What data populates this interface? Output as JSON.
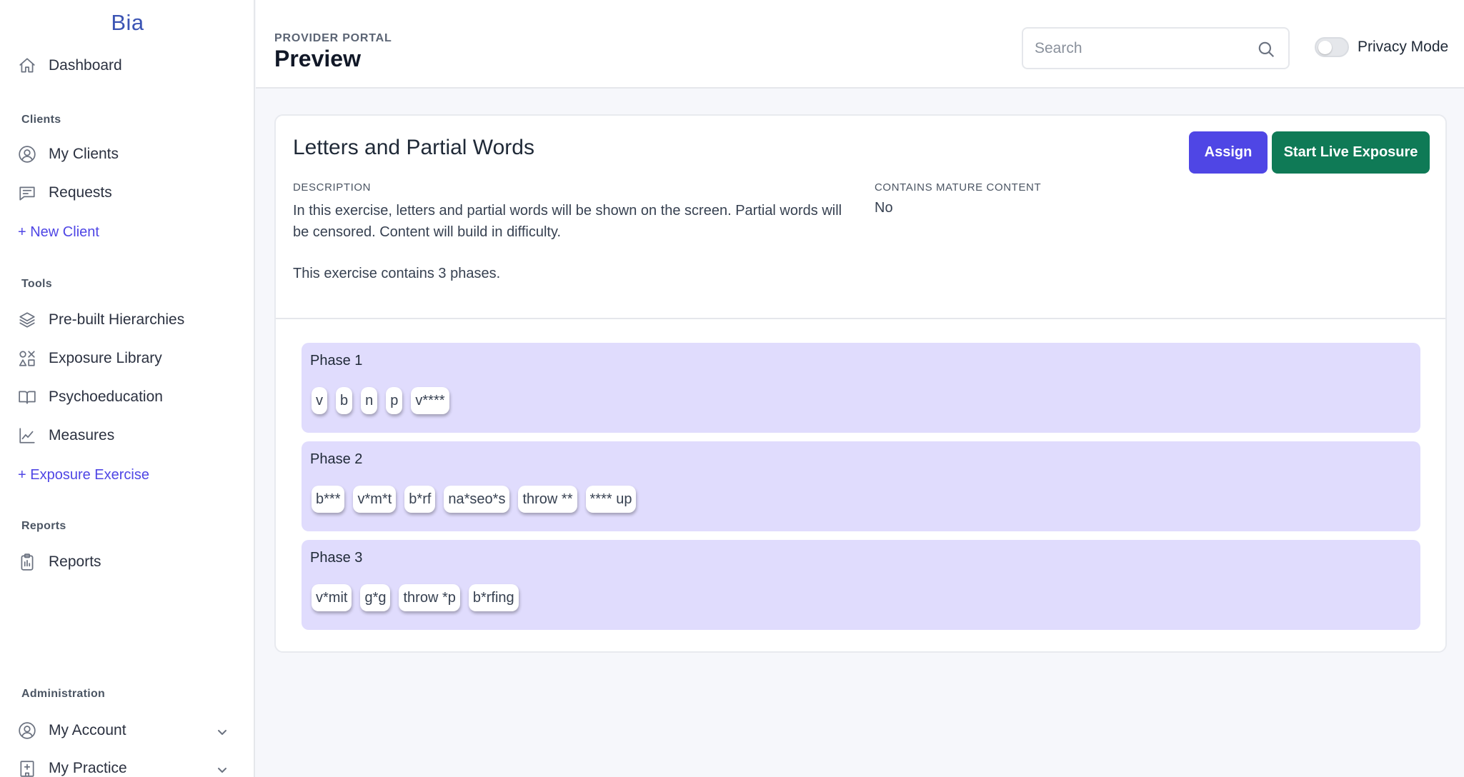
{
  "sidebar": {
    "brand": "Bia",
    "dashboard": "Dashboard",
    "sections": {
      "clients": "Clients",
      "tools": "Tools",
      "reports": "Reports",
      "administration": "Administration"
    },
    "items": {
      "my_clients": "My Clients",
      "requests": "Requests",
      "new_client": "+ New Client",
      "prebuilt_hierarchies": "Pre-built Hierarchies",
      "exposure_library": "Exposure Library",
      "psychoeducation": "Psychoeducation",
      "measures": "Measures",
      "exposure_exercise": "+ Exposure Exercise",
      "reports": "Reports",
      "my_account": "My Account",
      "my_practice": "My Practice"
    }
  },
  "header": {
    "portal_label": "PROVIDER PORTAL",
    "title": "Preview",
    "search_placeholder": "Search",
    "privacy_mode_label": "Privacy Mode"
  },
  "exercise": {
    "title": "Letters and Partial Words",
    "assign_label": "Assign",
    "start_live_label": "Start Live Exposure",
    "description_label": "DESCRIPTION",
    "description": "In this exercise, letters and partial words will be shown on the screen. Partial words will be censored. Content will build in difficulty.",
    "phase_count_text": "This exercise contains 3 phases.",
    "mature_label": "CONTAINS MATURE CONTENT",
    "mature_value": "No"
  },
  "phases": [
    {
      "title": "Phase 1",
      "items": [
        "v",
        "b",
        "n",
        "p",
        "v****"
      ]
    },
    {
      "title": "Phase 2",
      "items": [
        "b***",
        "v*m*t",
        "b*rf",
        "na*seo*s",
        "throw **",
        "**** up"
      ]
    },
    {
      "title": "Phase 3",
      "items": [
        "v*mit",
        "g*g",
        "throw *p",
        "b*rfing"
      ]
    }
  ],
  "colors": {
    "accent": "#4f46e5",
    "live_button": "#0f7a56",
    "phase_bg": "#e0dcfd",
    "brand": "#3b54b4"
  }
}
